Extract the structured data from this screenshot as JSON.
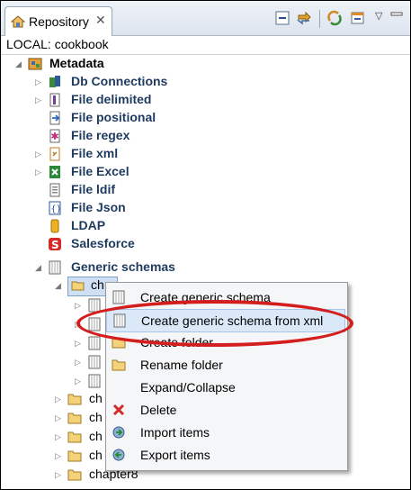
{
  "tab": {
    "label": "Repository",
    "close": "✕"
  },
  "path": {
    "label": "LOCAL: cookbook"
  },
  "tree": {
    "metadata": "Metadata",
    "items": [
      {
        "label": "Db Connections"
      },
      {
        "label": "File delimited"
      },
      {
        "label": "File positional"
      },
      {
        "label": "File regex"
      },
      {
        "label": "File xml"
      },
      {
        "label": "File Excel"
      },
      {
        "label": "File ldif"
      },
      {
        "label": "File Json"
      },
      {
        "label": "LDAP"
      },
      {
        "label": "Salesforce"
      },
      {
        "label": "Generic schemas"
      }
    ],
    "selected_folder": "ch",
    "sub_folders": [
      "ch",
      "ch",
      "ch",
      "ch",
      "chapter8"
    ]
  },
  "context_menu": {
    "items": [
      {
        "label": "Create generic schema"
      },
      {
        "label": "Create generic schema from xml"
      },
      {
        "label": "Create folder"
      },
      {
        "label": "Rename folder"
      },
      {
        "label": "Expand/Collapse"
      },
      {
        "label": "Delete"
      },
      {
        "label": "Import items"
      },
      {
        "label": "Export items"
      }
    ]
  },
  "colors": {
    "highlight_ring": "#d41e1e",
    "folder": "#e8b84a"
  }
}
